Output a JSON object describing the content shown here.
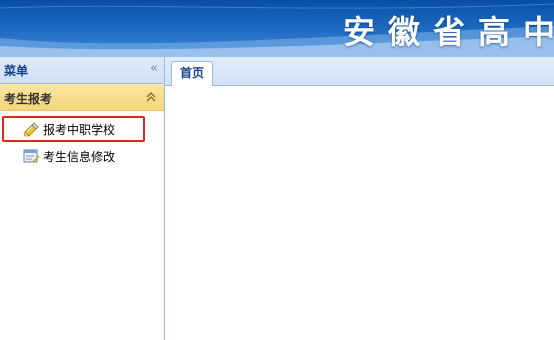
{
  "banner": {
    "title": "安徽省高中"
  },
  "sidebar": {
    "header": {
      "title": "菜单"
    },
    "group": {
      "title": "考生报考"
    },
    "items": [
      {
        "label": "报考中职学校",
        "icon": "notepad-pen-icon",
        "highlighted": true
      },
      {
        "label": "考生信息修改",
        "icon": "form-edit-icon",
        "highlighted": false
      }
    ]
  },
  "tabs": [
    {
      "label": "首页",
      "active": true
    }
  ],
  "colors": {
    "banner": "#1d6ac2",
    "panel_header": "#dfeaf8",
    "group_header": "#f6d47a",
    "highlight": "#e0271a",
    "border": "#99bbe8"
  }
}
